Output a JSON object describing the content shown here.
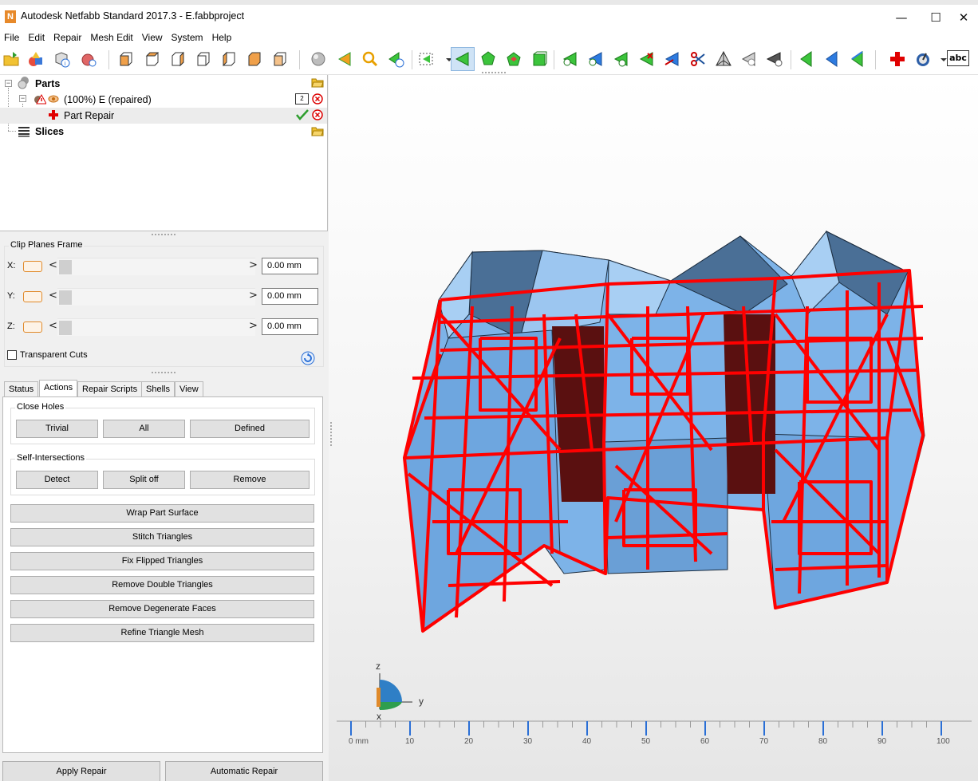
{
  "window": {
    "title": "Autodesk Netfabb Standard 2017.3 - E.fabbproject",
    "logo_letter": "N",
    "minimize": "—",
    "maximize": "☐",
    "close": "✕"
  },
  "menu": [
    "File",
    "Edit",
    "Repair",
    "Mesh Edit",
    "View",
    "System",
    "Help"
  ],
  "toolbar": {
    "text_button": "abc"
  },
  "tree": {
    "parts_label": "Parts",
    "part_label": "(100%) E (repaired)",
    "part_badge": "2",
    "repair_label": "Part Repair",
    "slices_label": "Slices",
    "expander_symbol": "−"
  },
  "clip_planes": {
    "title": "Clip Planes Frame",
    "axes": [
      {
        "label": "X:",
        "value": "0.00 mm"
      },
      {
        "label": "Y:",
        "value": "0.00 mm"
      },
      {
        "label": "Z:",
        "value": "0.00 mm"
      }
    ],
    "transparent_cuts": "Transparent Cuts",
    "arrow_left": "<",
    "arrow_right": ">"
  },
  "tabs": [
    "Status",
    "Actions",
    "Repair Scripts",
    "Shells",
    "View"
  ],
  "active_tab": "Actions",
  "actions": {
    "close_holes": {
      "title": "Close Holes",
      "buttons": [
        "Trivial",
        "All",
        "Defined"
      ]
    },
    "self_intersections": {
      "title": "Self-Intersections",
      "buttons": [
        "Detect",
        "Split off",
        "Remove"
      ]
    },
    "wide_buttons": [
      "Wrap Part Surface",
      "Stitch Triangles",
      "Fix Flipped Triangles",
      "Remove Double Triangles",
      "Remove Degenerate Faces",
      "Refine Triangle Mesh"
    ]
  },
  "bottom_buttons": {
    "apply": "Apply Repair",
    "automatic": "Automatic Repair"
  },
  "viewport": {
    "axis_z": "z",
    "axis_y": "y",
    "axis_x": "x",
    "ruler_ticks": [
      "0 mm",
      "10",
      "20",
      "30",
      "40",
      "50",
      "60",
      "70",
      "80",
      "90",
      "100"
    ]
  },
  "colors": {
    "mesh_fill": "#7db3e8",
    "mesh_dark": "#4a6f96",
    "error_edges": "#ff0000",
    "inner_dark": "#5a1010",
    "accent_orange": "#e08a2a"
  },
  "icons": {
    "part_status": "warning-icon",
    "part_visibility": "eye-icon",
    "repair": "red-cross-icon",
    "apply": "green-check-icon",
    "remove": "red-x-circle-icon",
    "parts_folder": "open-folder-icon",
    "slices": "slices-stack-icon",
    "refresh": "refresh-icon"
  }
}
